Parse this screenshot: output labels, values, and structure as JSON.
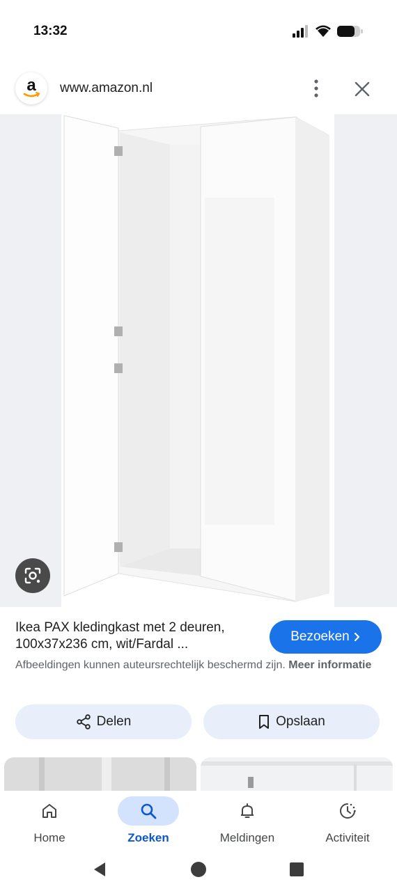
{
  "status": {
    "time": "13:32"
  },
  "url_bar": {
    "logo_letter": "a",
    "url": "www.amazon.nl"
  },
  "result": {
    "title": "Ikea PAX kledingkast met 2 deuren, 100x37x236 cm, wit/Fardal ...",
    "visit_label": "Bezoeken",
    "copyright_text": "Afbeeldingen kunnen auteursrechtelijk beschermd zijn.",
    "more_info_label": "Meer informatie"
  },
  "actions": {
    "share_label": "Delen",
    "save_label": "Opslaan"
  },
  "bottom_nav": {
    "items": [
      {
        "label": "Home",
        "icon": "home-icon"
      },
      {
        "label": "Zoeken",
        "icon": "search-icon",
        "active": true
      },
      {
        "label": "Meldingen",
        "icon": "bell-icon"
      },
      {
        "label": "Activiteit",
        "icon": "activity-icon"
      }
    ]
  },
  "colors": {
    "accent": "#1a73e8",
    "active_nav": "#0b57d0",
    "pill_bg": "#e8eefa",
    "image_bg": "#eef0f3"
  }
}
